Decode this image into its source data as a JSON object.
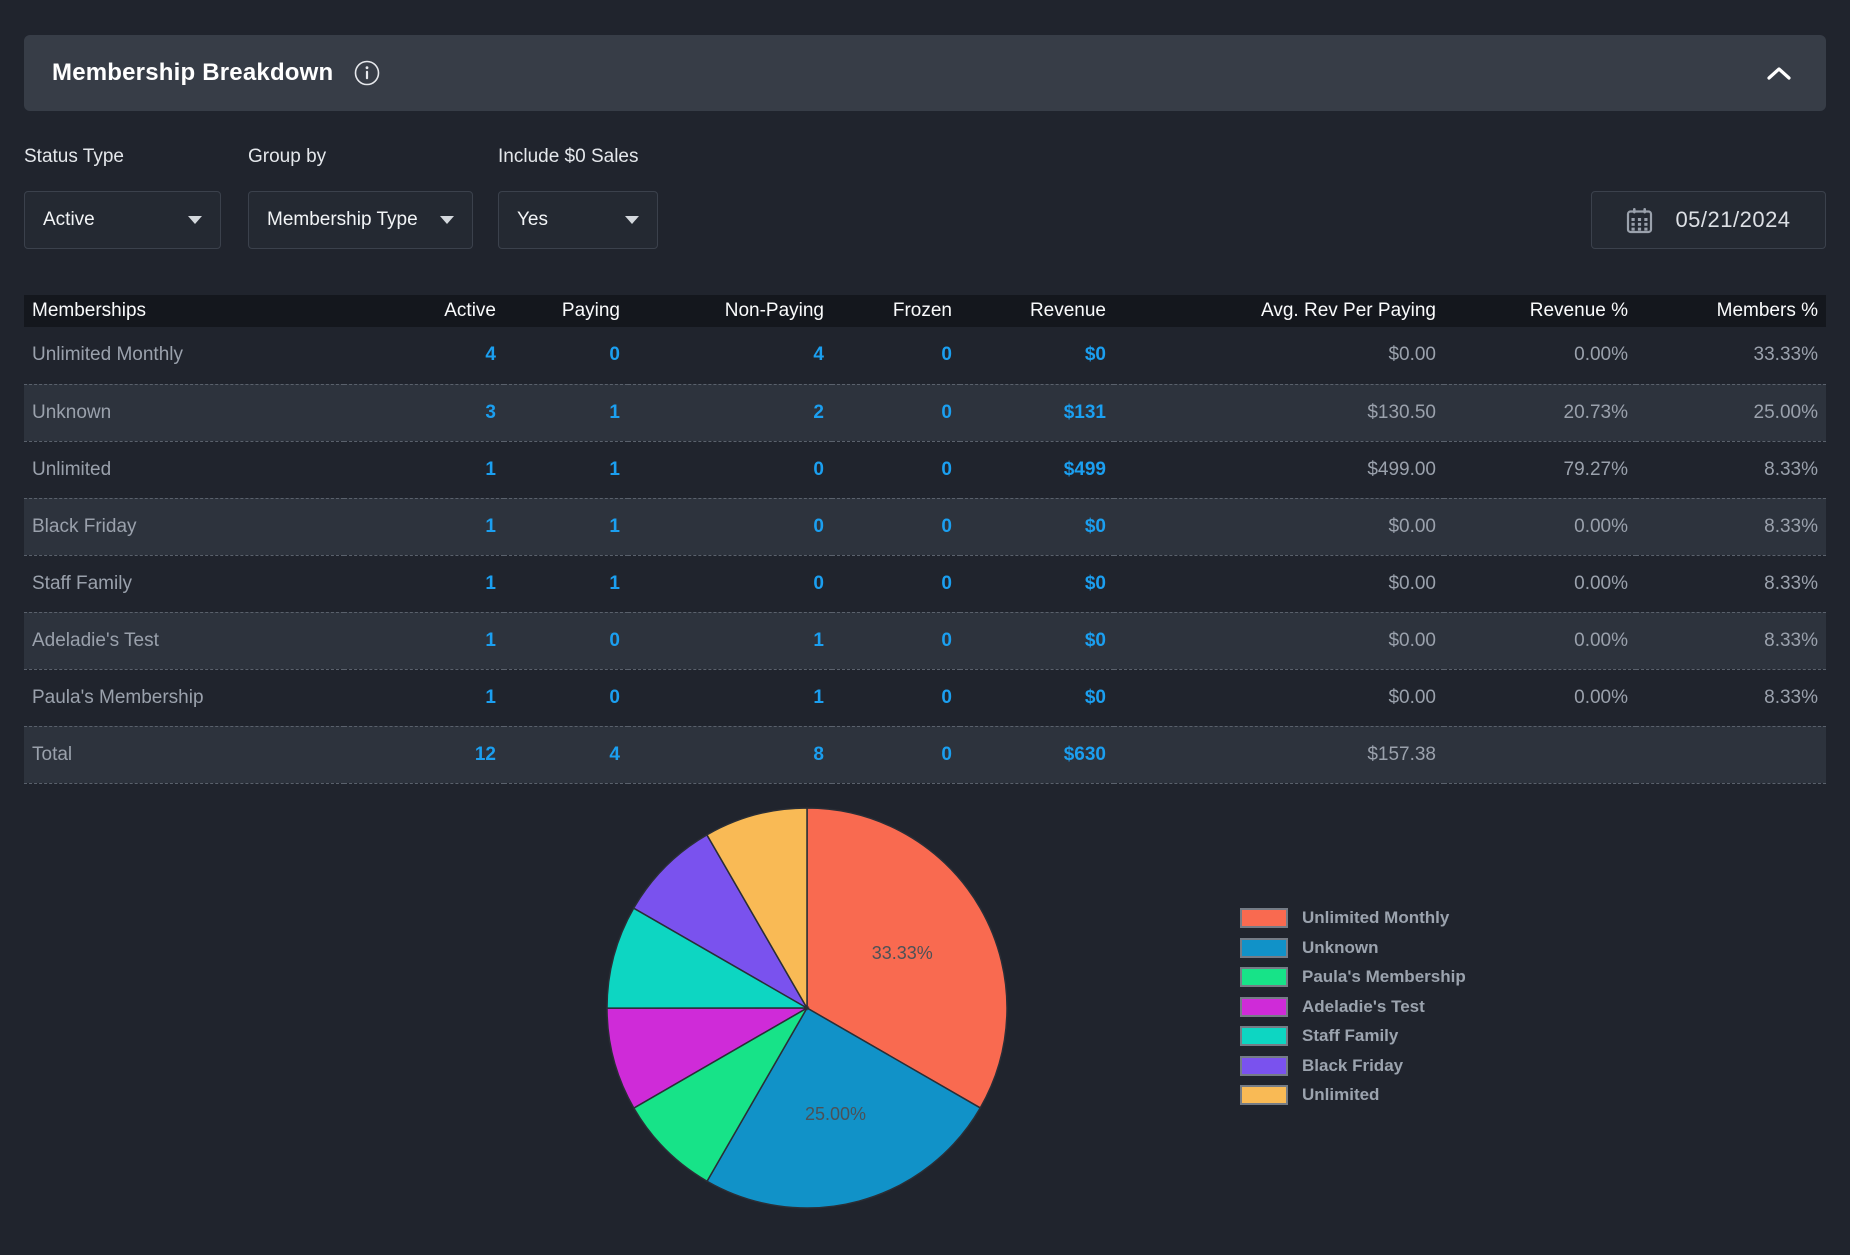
{
  "panel": {
    "title": "Membership Breakdown"
  },
  "filters": {
    "status_type": {
      "label": "Status Type",
      "value": "Active"
    },
    "group_by": {
      "label": "Group by",
      "value": "Membership Type"
    },
    "include_zero_sales": {
      "label": "Include $0 Sales",
      "value": "Yes"
    }
  },
  "date_picker": {
    "value": "05/21/2024"
  },
  "table": {
    "columns": [
      "Memberships",
      "Active",
      "Paying",
      "Non-Paying",
      "Frozen",
      "Revenue",
      "Avg. Rev Per Paying",
      "Revenue %",
      "Members %"
    ],
    "rows": [
      [
        "Unlimited Monthly",
        "4",
        "0",
        "4",
        "0",
        "$0",
        "$0.00",
        "0.00%",
        "33.33%"
      ],
      [
        "Unknown",
        "3",
        "1",
        "2",
        "0",
        "$131",
        "$130.50",
        "20.73%",
        "25.00%"
      ],
      [
        "Unlimited",
        "1",
        "1",
        "0",
        "0",
        "$499",
        "$499.00",
        "79.27%",
        "8.33%"
      ],
      [
        "Black Friday",
        "1",
        "1",
        "0",
        "0",
        "$0",
        "$0.00",
        "0.00%",
        "8.33%"
      ],
      [
        "Staff Family",
        "1",
        "1",
        "0",
        "0",
        "$0",
        "$0.00",
        "0.00%",
        "8.33%"
      ],
      [
        "Adeladie's Test",
        "1",
        "0",
        "1",
        "0",
        "$0",
        "$0.00",
        "0.00%",
        "8.33%"
      ],
      [
        "Paula's Membership",
        "1",
        "0",
        "1",
        "0",
        "$0",
        "$0.00",
        "0.00%",
        "8.33%"
      ],
      [
        "Total",
        "12",
        "4",
        "8",
        "0",
        "$630",
        "$157.38",
        "",
        ""
      ]
    ]
  },
  "chart_data": {
    "type": "pie",
    "title": "",
    "legend_position": "right",
    "start_angle_deg": 0,
    "direction": "clockwise",
    "slices": [
      {
        "label": "Unlimited Monthly",
        "value": 33.33,
        "color": "#F96A50",
        "slice_label": "33.33%"
      },
      {
        "label": "Unknown",
        "value": 25.0,
        "color": "#1192C8",
        "slice_label": "25.00%"
      },
      {
        "label": "Paula's Membership",
        "value": 8.33,
        "color": "#17E388",
        "slice_label": ""
      },
      {
        "label": "Adeladie's Test",
        "value": 8.33,
        "color": "#CF2BD8",
        "slice_label": ""
      },
      {
        "label": "Staff Family",
        "value": 8.33,
        "color": "#0DD6C2",
        "slice_label": ""
      },
      {
        "label": "Black Friday",
        "value": 8.34,
        "color": "#7A52EE",
        "slice_label": ""
      },
      {
        "label": "Unlimited",
        "value": 8.34,
        "color": "#F9BA55",
        "slice_label": ""
      }
    ]
  },
  "colors": {
    "page_bg": "#20242D",
    "panel_header_bg": "#373D47",
    "table_header_bg": "#14171D",
    "row_alt_bg": "#2D333D",
    "accent_number": "#1B9FF0",
    "muted_text": "#9AA1AC",
    "slice_label_text": "#4C5157"
  }
}
